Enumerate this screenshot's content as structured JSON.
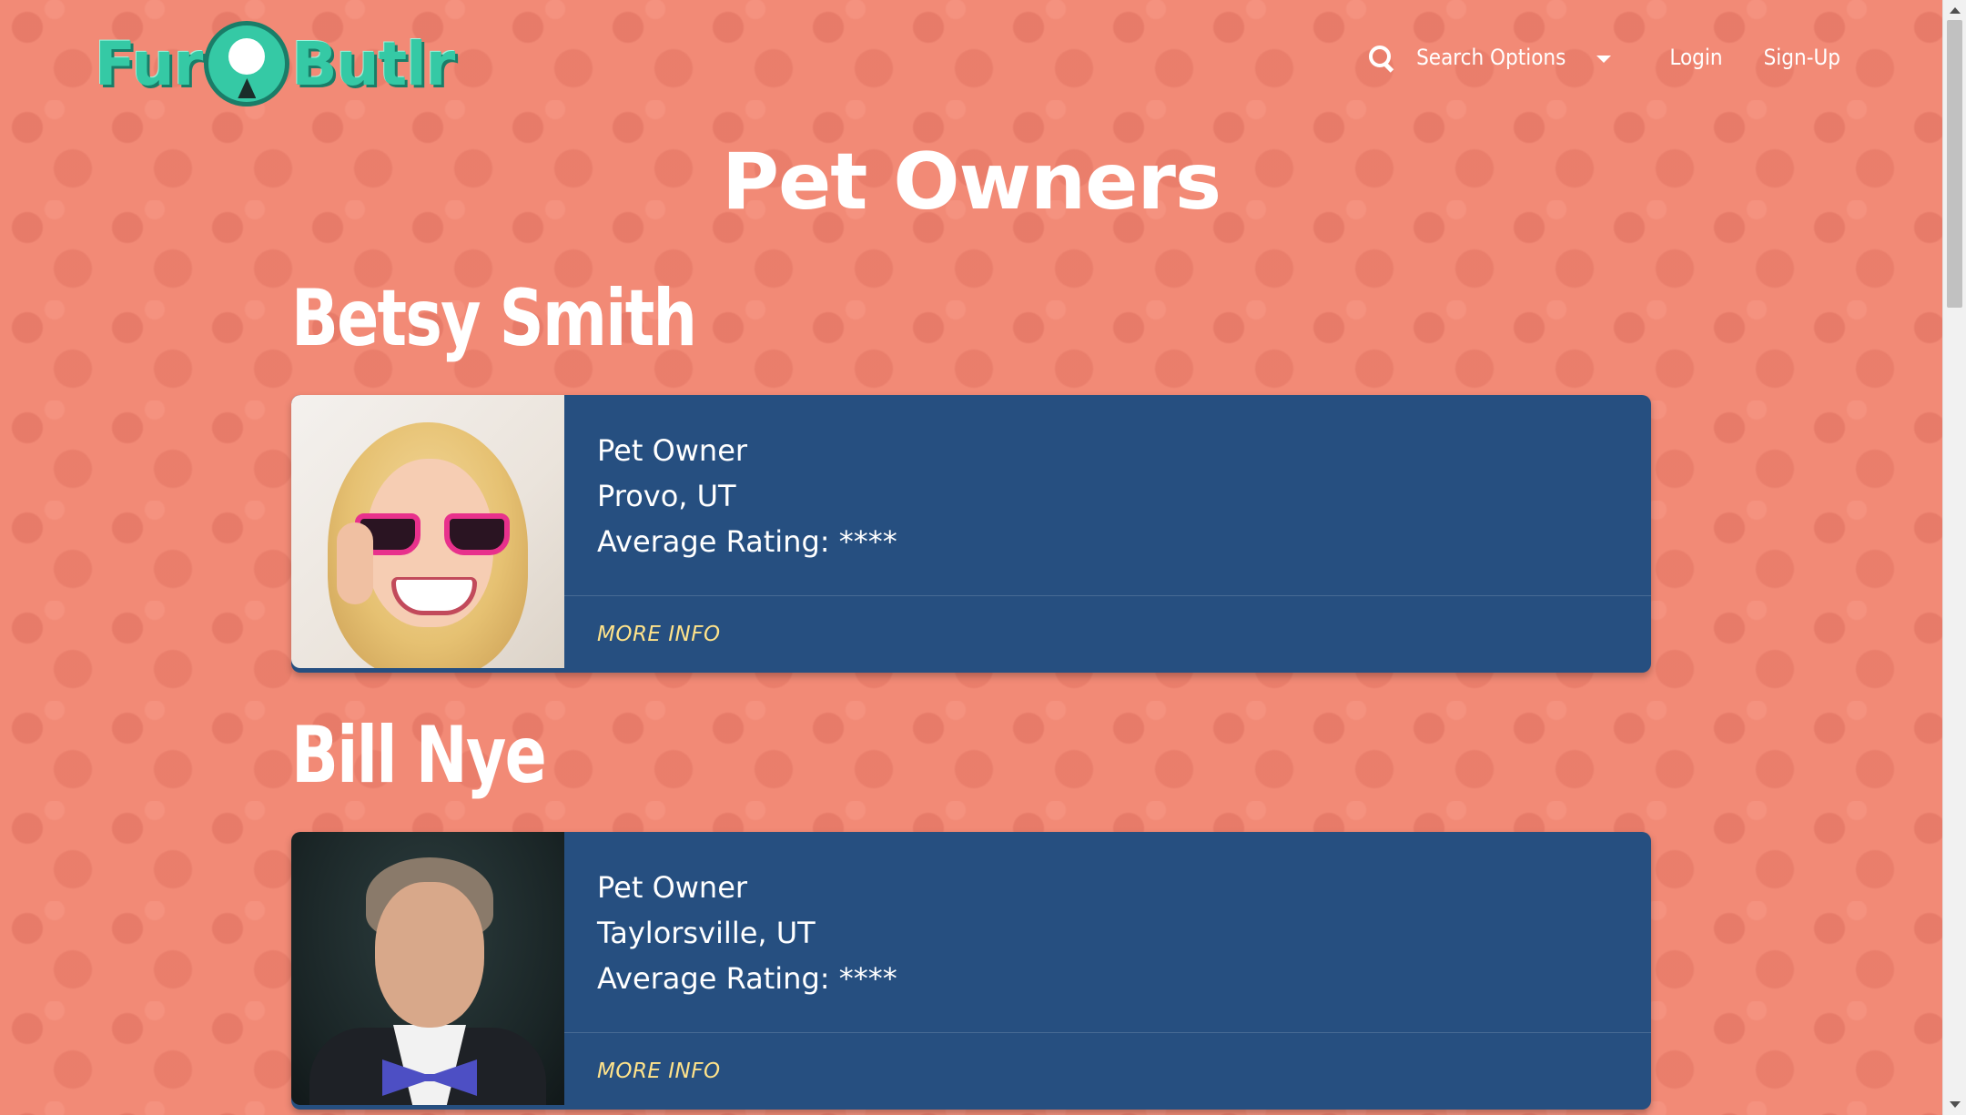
{
  "header": {
    "logo_text_left": "Fur",
    "logo_text_right": "Butlr",
    "search_icon": "search-icon",
    "search_options_label": "Search Options",
    "login_label": "Login",
    "signup_label": "Sign-Up"
  },
  "page": {
    "title": "Pet Owners"
  },
  "owners": [
    {
      "name": "Betsy Smith",
      "role": "Pet Owner",
      "location": "Provo, UT",
      "rating": "Average Rating: ****",
      "action_label": "MORE INFO"
    },
    {
      "name": "Bill Nye",
      "role": "Pet Owner",
      "location": "Taylorsville, UT",
      "rating": "Average Rating: ****",
      "action_label": "MORE INFO"
    }
  ],
  "colors": {
    "background": "#f28a76",
    "card": "#264f80",
    "logo": "#35c9a5",
    "link": "#ffe38a"
  }
}
